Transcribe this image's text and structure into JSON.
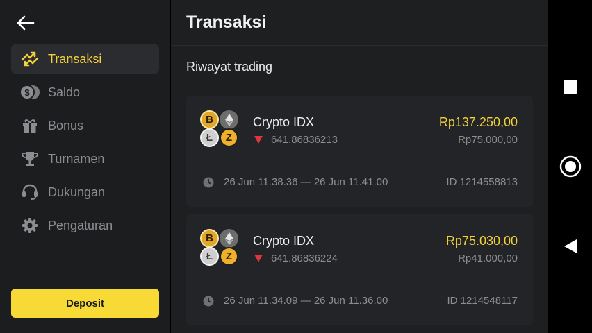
{
  "sidebar": {
    "items": [
      {
        "label": "Transaksi",
        "icon": "transactions-icon",
        "active": true
      },
      {
        "label": "Saldo",
        "icon": "coins-icon",
        "active": false
      },
      {
        "label": "Bonus",
        "icon": "gift-icon",
        "active": false
      },
      {
        "label": "Turnamen",
        "icon": "trophy-icon",
        "active": false
      },
      {
        "label": "Dukungan",
        "icon": "headset-icon",
        "active": false
      },
      {
        "label": "Pengaturan",
        "icon": "gear-icon",
        "active": false
      }
    ],
    "deposit_label": "Deposit"
  },
  "main": {
    "title": "Transaksi",
    "section_title": "Riwayat trading",
    "trades": [
      {
        "asset": "Crypto IDX",
        "rate": "641.86836213",
        "direction": "down",
        "payout": "Rp137.250,00",
        "investment": "Rp75.000,00",
        "time_range": "26 Jun  11.38.36 — 26 Jun  11.41.00",
        "trade_id": "ID 1214558813"
      },
      {
        "asset": "Crypto IDX",
        "rate": "641.86836224",
        "direction": "down",
        "payout": "Rp75.030,00",
        "investment": "Rp41.000,00",
        "time_range": "26 Jun  11.34.09 — 26 Jun  11.36.00",
        "trade_id": "ID 1214548117"
      }
    ]
  },
  "colors": {
    "accent": "#f7da36",
    "down": "#e0353f",
    "background": "#1e1f21",
    "sidebar": "#1c1d1f",
    "card": "#232427"
  },
  "system_nav": {
    "buttons": [
      "recents-square-icon",
      "home-circle-icon",
      "back-triangle-icon"
    ]
  }
}
